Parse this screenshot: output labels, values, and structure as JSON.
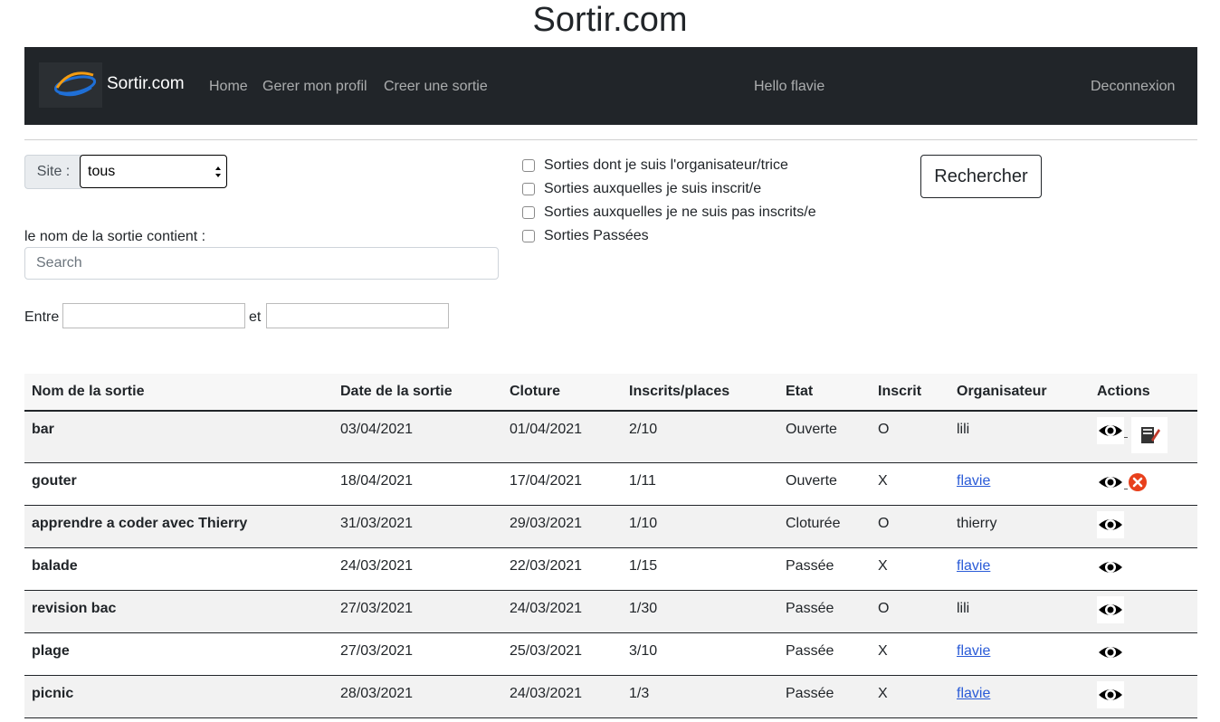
{
  "page_title": "Sortir.com",
  "navbar": {
    "brand": "Sortir.com",
    "links": [
      "Home",
      "Gerer mon profil",
      "Creer une sortie"
    ],
    "greeting": "Hello flavie",
    "logout": "Deconnexion"
  },
  "filters": {
    "site_label": "Site :",
    "site_value": "tous",
    "name_label": "le nom de la sortie contient :",
    "search_placeholder": "Search",
    "between_label": "Entre",
    "and_label": "et",
    "checkboxes": [
      {
        "label": "Sorties dont je suis l'organisateur/trice",
        "checked": false
      },
      {
        "label": "Sorties auxquelles je suis inscrit/e",
        "checked": false
      },
      {
        "label": "Sorties auxquelles je ne suis pas inscrits/e",
        "checked": false
      },
      {
        "label": "Sorties Passées",
        "checked": false
      }
    ],
    "search_button": "Rechercher"
  },
  "table": {
    "headers": [
      "Nom de la sortie",
      "Date de la sortie",
      "Cloture",
      "Inscrits/places",
      "Etat",
      "Inscrit",
      "Organisateur",
      "Actions"
    ],
    "rows": [
      {
        "name": "bar",
        "date": "03/04/2021",
        "cloture": "01/04/2021",
        "places": "2/10",
        "etat": "Ouverte",
        "inscrit": "O",
        "organisateur": "lili",
        "org_link": false,
        "actions": [
          "view",
          "edit"
        ]
      },
      {
        "name": "gouter",
        "date": "18/04/2021",
        "cloture": "17/04/2021",
        "places": "1/11",
        "etat": "Ouverte",
        "inscrit": "X",
        "organisateur": "flavie",
        "org_link": true,
        "actions": [
          "view",
          "cancel"
        ]
      },
      {
        "name": "apprendre a coder avec Thierry",
        "date": "31/03/2021",
        "cloture": "29/03/2021",
        "places": "1/10",
        "etat": "Cloturée",
        "inscrit": "O",
        "organisateur": "thierry",
        "org_link": false,
        "actions": [
          "view"
        ]
      },
      {
        "name": "balade",
        "date": "24/03/2021",
        "cloture": "22/03/2021",
        "places": "1/15",
        "etat": "Passée",
        "inscrit": "X",
        "organisateur": "flavie",
        "org_link": true,
        "actions": [
          "view"
        ]
      },
      {
        "name": "revision bac",
        "date": "27/03/2021",
        "cloture": "24/03/2021",
        "places": "1/30",
        "etat": "Passée",
        "inscrit": "O",
        "organisateur": "lili",
        "org_link": false,
        "actions": [
          "view"
        ]
      },
      {
        "name": "plage",
        "date": "27/03/2021",
        "cloture": "25/03/2021",
        "places": "3/10",
        "etat": "Passée",
        "inscrit": "X",
        "organisateur": "flavie",
        "org_link": true,
        "actions": [
          "view"
        ]
      },
      {
        "name": "picnic",
        "date": "28/03/2021",
        "cloture": "24/03/2021",
        "places": "1/3",
        "etat": "Passée",
        "inscrit": "X",
        "organisateur": "flavie",
        "org_link": true,
        "actions": [
          "view"
        ]
      }
    ]
  },
  "icons": {
    "view": "eye-icon",
    "edit": "edit-icon",
    "cancel": "cancel-icon"
  },
  "colors": {
    "navbar_bg": "#212529",
    "link": "#2a5bd7",
    "cancel": "#e8401c"
  }
}
